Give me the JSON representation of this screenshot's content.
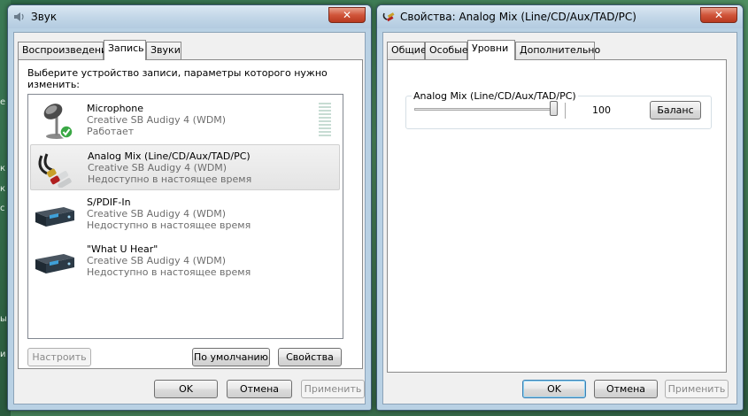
{
  "sound_window": {
    "title": "Звук",
    "close_label": "✕",
    "tabs": [
      "Воспроизведение",
      "Запись",
      "Звуки"
    ],
    "active_tab": "Запись",
    "description": "Выберите устройство записи, параметры которого нужно изменить:",
    "devices": [
      {
        "name": "Microphone",
        "driver": "Creative SB Audigy 4 (WDM)",
        "status": "Работает",
        "icon": "microphone-icon",
        "default": true
      },
      {
        "name": "Analog Mix (Line/CD/Aux/TAD/PC)",
        "driver": "Creative SB Audigy 4 (WDM)",
        "status": "Недоступно в настоящее время",
        "icon": "rca-cable-icon",
        "selected": true
      },
      {
        "name": "S/PDIF-In",
        "driver": "Creative SB Audigy 4 (WDM)",
        "status": "Недоступно в настоящее время",
        "icon": "sound-card-icon"
      },
      {
        "name": "\"What U Hear\"",
        "driver": "Creative SB Audigy 4 (WDM)",
        "status": "Недоступно в настоящее время",
        "icon": "sound-card-icon"
      }
    ],
    "buttons": {
      "configure": "Настроить",
      "set_default": "По умолчанию",
      "properties": "Свойства",
      "ok": "OK",
      "cancel": "Отмена",
      "apply": "Применить"
    }
  },
  "props_window": {
    "title": "Свойства: Analog Mix (Line/CD/Aux/TAD/PC)",
    "close_label": "✕",
    "tabs": [
      "Общие",
      "Особые",
      "Уровни",
      "Дополнительно"
    ],
    "active_tab": "Уровни",
    "level_group_label": "Analog Mix (Line/CD/Aux/TAD/PC)",
    "volume_value": "100",
    "balance_label": "Баланс",
    "buttons": {
      "ok": "OK",
      "cancel": "Отмена",
      "apply": "Применить"
    }
  },
  "colors": {
    "accent": "#3c7fb1",
    "close": "#c94a2e",
    "check": "#3aa845"
  }
}
